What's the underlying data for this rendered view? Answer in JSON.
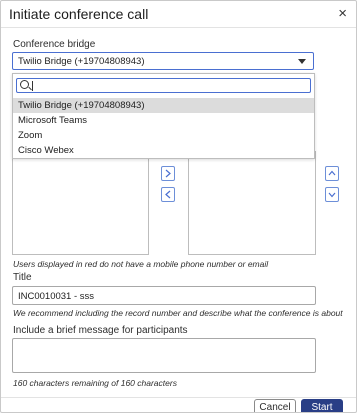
{
  "dialog": {
    "title": "Initiate conference call",
    "close_glyph": "×"
  },
  "bridge": {
    "label": "Conference bridge",
    "selected": "Twilio Bridge (+19704808943)",
    "options": [
      "Twilio Bridge (+19704808943)",
      "Microsoft Teams",
      "Zoom",
      "Cisco Webex"
    ]
  },
  "transfer": {
    "move_right_icon": "chevron-right-icon",
    "move_left_icon": "chevron-left-icon",
    "move_up_icon": "chevron-up-icon",
    "move_down_icon": "chevron-down-icon"
  },
  "notes": {
    "red_users": "Users displayed in red do not have a mobile phone number or email",
    "title_hint": "We recommend including the record number and describe what the conference is about",
    "char_count": "160 characters remaining of 160 characters"
  },
  "title_field": {
    "label": "Title",
    "value": "INC0010031 - sss"
  },
  "message_field": {
    "label": "Include a brief message for participants",
    "value": ""
  },
  "footer": {
    "cancel_label": "Cancel",
    "start_label": "Start"
  },
  "colors": {
    "accent": "#293e86",
    "focus_border": "#4a6fd1",
    "selected_option_bg": "#dcdcdc"
  }
}
